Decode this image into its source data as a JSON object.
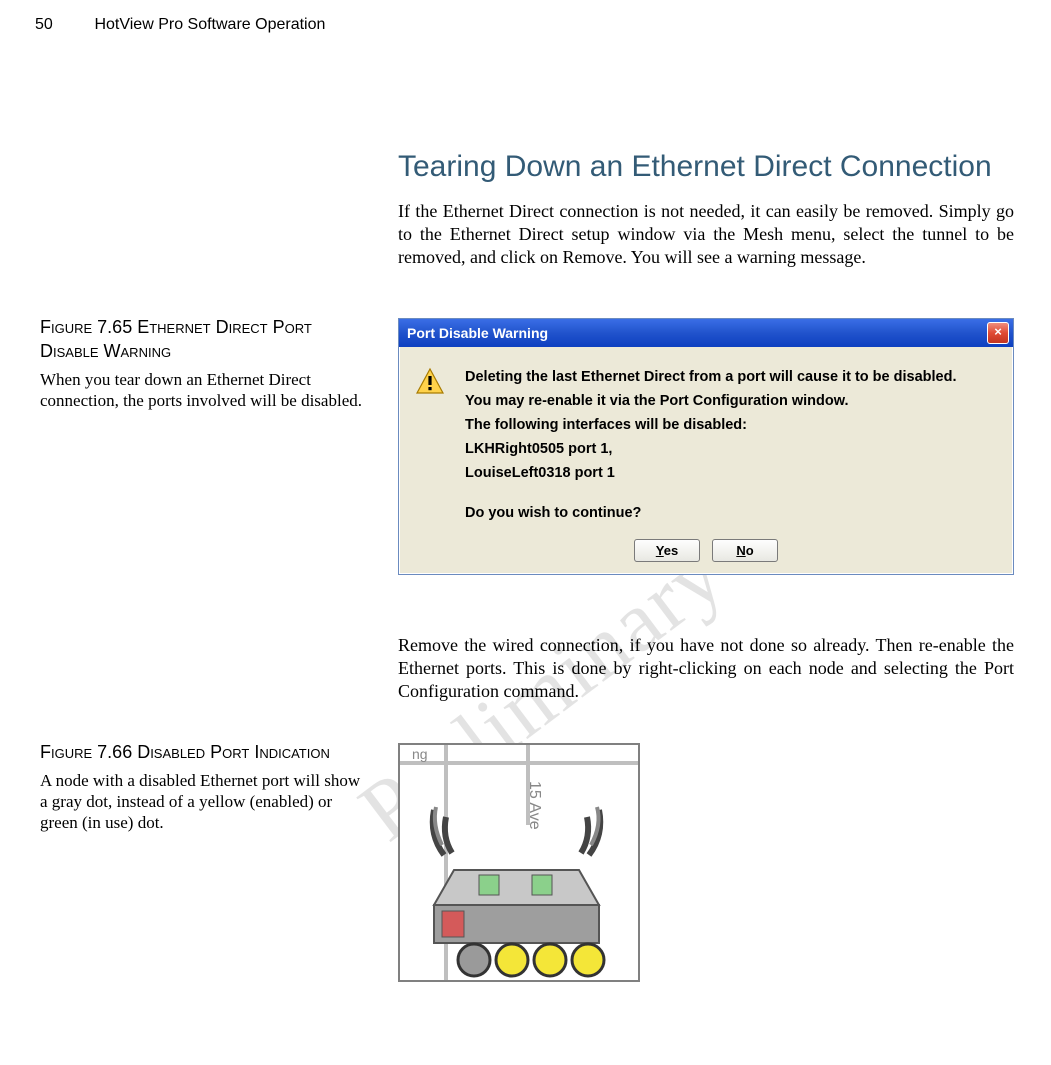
{
  "header": {
    "page_number": "50",
    "running_title": "HotView Pro Software Operation"
  },
  "section": {
    "heading": "Tearing Down an Ethernet Direct Connection",
    "para1": "If the Ethernet Direct connection is not needed, it can easily be removed. Simply go to the Ethernet Direct setup window via the Mesh menu, select the tunnel to be removed, and click on Remove. You will see a warning message.",
    "para2": "Remove the wired connection, if you have not done so already. Then re-enable the Ethernet ports. This is done by right-clicking on each node and selecting the Port Configuration command."
  },
  "figure1": {
    "title_label": "Figure 7.65 Ethernet Direct Port Disable Warning",
    "body": "When you tear down an Ethernet Direct connection, the ports involved will be disabled."
  },
  "figure2": {
    "title_label": "Figure 7.66 Disabled Port Indication",
    "body": "A node with a disabled Ethernet port will show a gray dot, instead of a yellow (enabled) or green (in use) dot."
  },
  "dialog": {
    "title": "Port Disable Warning",
    "close_label": "×",
    "line1": "Deleting the last Ethernet Direct from a port will cause it to be disabled.",
    "line2": "You may re-enable it via the Port Configuration window.",
    "line3": "The following interfaces will be disabled:",
    "line4": "LKHRight0505 port 1,",
    "line5": "LouiseLeft0318 port 1",
    "line6": "Do you wish to continue?",
    "yes_underline": "Y",
    "yes_rest": "es",
    "no_underline": "N",
    "no_rest": "o"
  },
  "node_figure": {
    "map_label_top": "ng",
    "street_label": "15 Ave",
    "port_status_colors": [
      "gray",
      "yellow",
      "yellow",
      "yellow"
    ]
  },
  "watermark": "Preliminary"
}
